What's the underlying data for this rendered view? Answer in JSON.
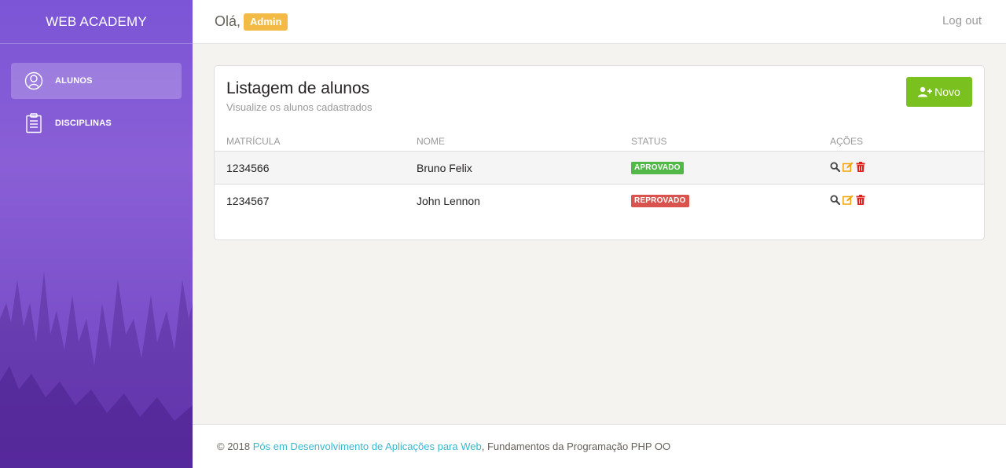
{
  "sidebar": {
    "brand": "WEB ACADEMY",
    "items": [
      {
        "label": "ALUNOS",
        "icon": "user-circle-icon",
        "active": true
      },
      {
        "label": "DISCIPLINAS",
        "icon": "clipboard-icon",
        "active": false
      }
    ]
  },
  "header": {
    "greeting": "Olá,",
    "user_badge": "Admin",
    "logout": "Log out"
  },
  "card": {
    "title": "Listagem de alunos",
    "subtitle": "Visualize os alunos cadastrados",
    "new_button": "Novo"
  },
  "table": {
    "headers": [
      "MATRÍCULA",
      "NOME",
      "STATUS",
      "AÇÕES"
    ],
    "rows": [
      {
        "matricula": "1234566",
        "nome": "Bruno Felix",
        "status": "APROVADO"
      },
      {
        "matricula": "1234567",
        "nome": "John Lennon",
        "status": "REPROVADO"
      }
    ]
  },
  "footer": {
    "prefix": "© 2018",
    "link": "Pós em Desenvolvimento de Aplicações para Web",
    "suffix": ", Fundamentos da Programação PHP OO"
  },
  "colors": {
    "sidebar": "#7b55d6",
    "badge_admin": "#f3bb45",
    "new_button": "#7ac01e",
    "approved": "#52b848",
    "rejected": "#d9534f",
    "footer_link": "#37b8cf"
  }
}
